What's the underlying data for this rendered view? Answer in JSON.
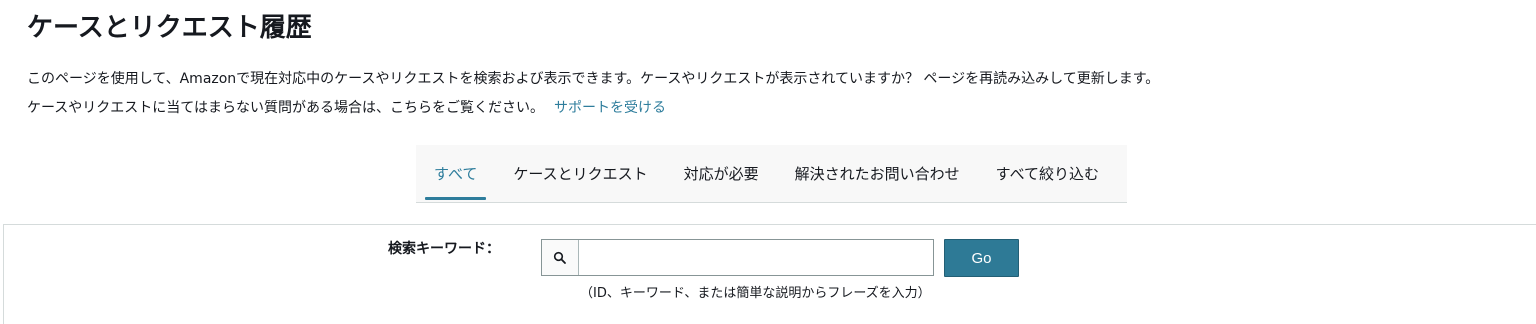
{
  "page": {
    "title": "ケースとリクエスト履歴",
    "description_line1": "このページを使用して、Amazonで現在対応中のケースやリクエストを検索および表示できます。ケースやリクエストが表示されていますか？ ページを再読み込みして更新します。",
    "description_line2": "ケースやリクエストに当てはまらない質問がある場合は、こちらをご覧ください。",
    "support_link": "サポートを受ける"
  },
  "tabs": [
    {
      "label": "すべて",
      "active": true
    },
    {
      "label": "ケースとリクエスト",
      "active": false
    },
    {
      "label": "対応が必要",
      "active": false
    },
    {
      "label": "解決されたお問い合わせ",
      "active": false
    },
    {
      "label": "すべて絞り込む",
      "active": false
    }
  ],
  "search": {
    "label": "検索キーワード：",
    "value": "",
    "placeholder": "",
    "icon": "search-icon",
    "go_label": "Go",
    "hint": "（ID、キーワード、または簡単な説明からフレーズを入力）"
  },
  "colors": {
    "accent": "#2e7d9c",
    "button": "#2e7a96"
  }
}
